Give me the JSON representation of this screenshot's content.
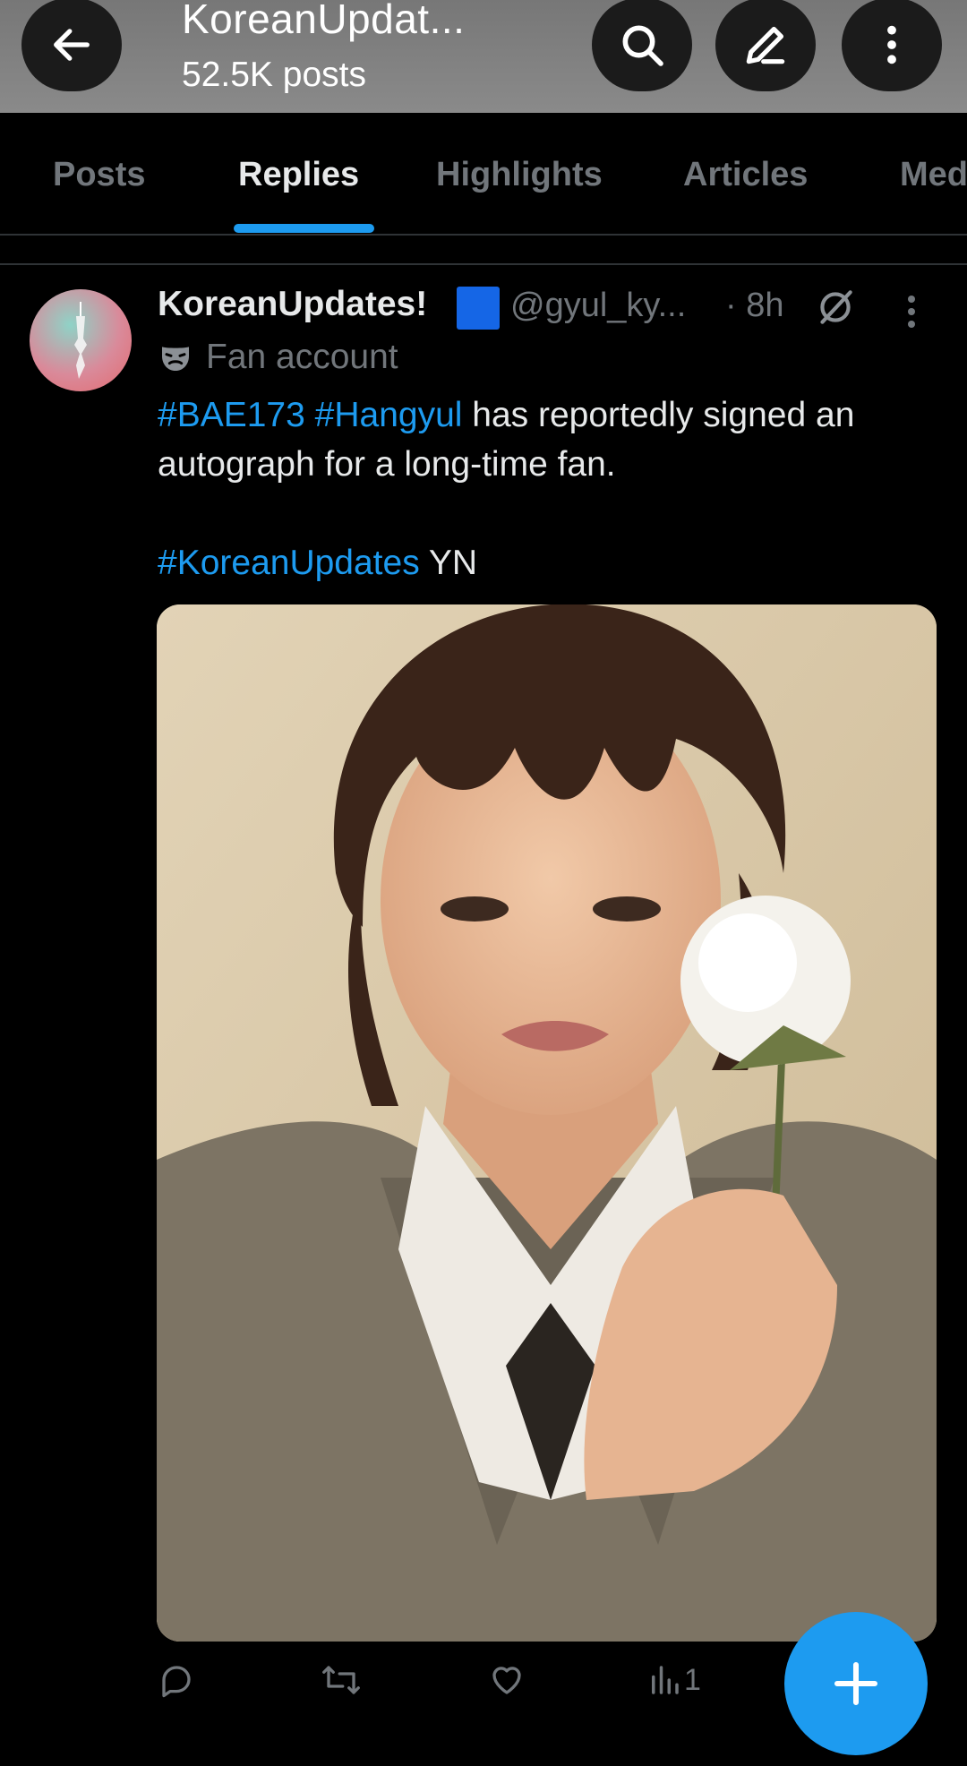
{
  "header": {
    "title": "KoreanUpdat...",
    "subtitle": "52.5K posts",
    "back_icon": "arrow-left-icon",
    "search_icon": "search-icon",
    "edit_icon": "pencil-icon",
    "more_icon": "more-vertical-icon"
  },
  "tabs": [
    {
      "label": "Posts",
      "active": false
    },
    {
      "label": "Replies",
      "active": true
    },
    {
      "label": "Highlights",
      "active": false
    },
    {
      "label": "Articles",
      "active": false
    },
    {
      "label": "Med",
      "active": false
    }
  ],
  "post": {
    "display_name": "KoreanUpdates!",
    "badge_icon": "blue-square-icon",
    "handle": "@gyul_ky...",
    "time": "· 8h",
    "label_icon": "mask-icon",
    "label": "Fan account",
    "text": {
      "tag1": "#BAE173",
      "tag2": "#Hangyul",
      "line1_rest": " has reportedly signed an autograph for a long-time fan.",
      "tag3": "#KoreanUpdates",
      "line2_rest": " YN"
    },
    "image_alt": "photo of a young man with dark hair in a grey suit holding a white rose",
    "actions": {
      "reply_icon": "reply-icon",
      "repost_icon": "repost-icon",
      "like_icon": "heart-icon",
      "views_icon": "views-bar-icon",
      "views_count": "1"
    }
  },
  "fab": {
    "icon": "plus-icon"
  },
  "colors": {
    "accent": "#1d9bf0",
    "background": "#000000",
    "muted": "#71767b",
    "text": "#e7e9ea"
  }
}
